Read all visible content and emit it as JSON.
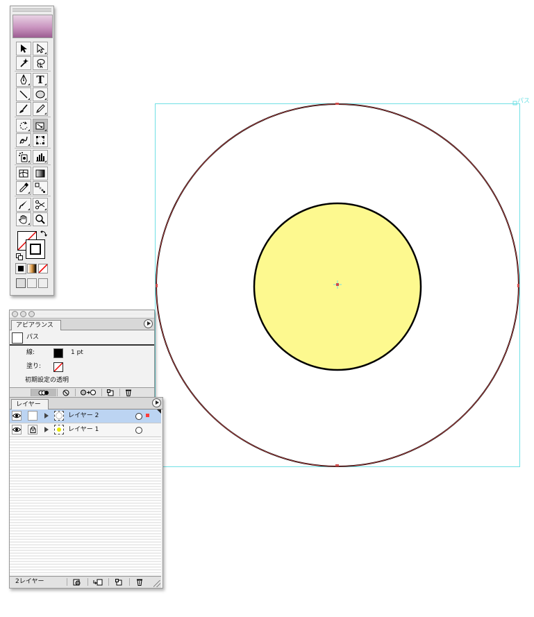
{
  "colors": {
    "selection": "#6fe0e5",
    "path_outline": "#d04a4a",
    "fill_yellow": "#fdf98f",
    "selected_row": "#bcd4f2",
    "layer2_color": "#ff3b3b",
    "layer1_color": "#e8e800"
  },
  "toolbox": {
    "tools": [
      {
        "name": "selection-tool",
        "icon": "arrow-icon"
      },
      {
        "name": "direct-selection-tool",
        "icon": "hollow-arrow-icon"
      },
      {
        "name": "magic-wand-tool",
        "icon": "wand-icon"
      },
      {
        "name": "lasso-tool",
        "icon": "lasso-icon"
      },
      {
        "name": "pen-tool",
        "icon": "pen-icon"
      },
      {
        "name": "type-tool",
        "icon": "type-icon",
        "glyph": "T"
      },
      {
        "name": "line-tool",
        "icon": "line-icon"
      },
      {
        "name": "ellipse-tool",
        "icon": "ellipse-icon"
      },
      {
        "name": "paintbrush-tool",
        "icon": "brush-icon"
      },
      {
        "name": "pencil-tool",
        "icon": "pencil-icon"
      },
      {
        "name": "rotate-tool",
        "icon": "rotate-icon"
      },
      {
        "name": "scale-tool",
        "icon": "scale-icon"
      },
      {
        "name": "warp-tool",
        "icon": "warp-icon"
      },
      {
        "name": "free-transform-tool",
        "icon": "free-transform-icon"
      },
      {
        "name": "symbol-sprayer-tool",
        "icon": "symbol-icon"
      },
      {
        "name": "column-graph-tool",
        "icon": "graph-icon"
      },
      {
        "name": "mesh-tool",
        "icon": "mesh-icon"
      },
      {
        "name": "gradient-tool",
        "icon": "gradient-icon"
      },
      {
        "name": "eyedropper-tool",
        "icon": "eyedropper-icon"
      },
      {
        "name": "blend-tool",
        "icon": "blend-icon"
      },
      {
        "name": "slice-tool",
        "icon": "slice-icon"
      },
      {
        "name": "scissors-tool",
        "icon": "scissors-icon"
      },
      {
        "name": "hand-tool",
        "icon": "hand-icon"
      },
      {
        "name": "zoom-tool",
        "icon": "magnifier-icon"
      }
    ]
  },
  "appearance": {
    "tab": "アピアランス",
    "object": "パス",
    "stroke_label": "線:",
    "stroke_value": "1 pt",
    "fill_label": "塗り:",
    "opacity_label": "初期設定の透明"
  },
  "layers": {
    "tab": "レイヤー",
    "items": [
      {
        "name": "レイヤー 2",
        "selected": true,
        "locked": false
      },
      {
        "name": "レイヤー 1",
        "selected": false,
        "locked": true
      }
    ],
    "count": "2レイヤー"
  },
  "canvas": {
    "path_tag": "パス"
  }
}
